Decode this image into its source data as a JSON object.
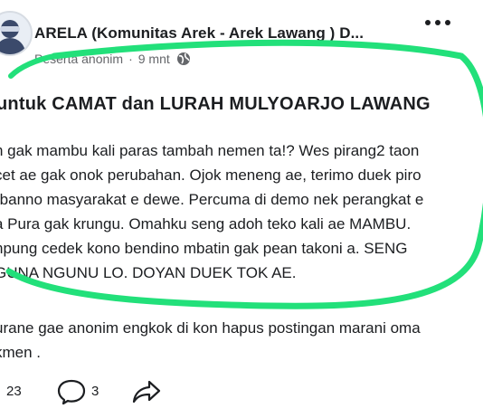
{
  "post": {
    "group_name": "ARELA (Komunitas Arek - Arek Lawang ) D...",
    "author": "Peserta anonim",
    "separator": "·",
    "time": "9 mnt",
    "title": "untuk CAMAT dan LURAH MULYOARJO LAWANG",
    "body_lines": [
      "n gak mambu kali paras tambah nemen ta!? Wes pirang2 taon",
      "cet ae gak onok perubahan. Ojok meneng ae, terimo duek piro",
      "rbanno masyarakat e dewe. Percuma di demo nek perangkat e",
      "a Pura gak krungu. Omahku seng adoh teko kali ae MAMBU.",
      "npung cedek kono bendino mbatin gak pean takoni a. SENG",
      "GUNA NGUNU LO. DOYAN DUEK TOK AE.",
      "urane gae anonim engkok di kon hapus postingan marani oma",
      "kmen ."
    ]
  },
  "footer": {
    "reactions": "23",
    "comments": "3"
  },
  "icons": {
    "more": "more-dots-icon",
    "privacy": "globe-icon",
    "comment": "comment-icon",
    "share": "share-icon"
  },
  "colors": {
    "highlight": "#22e07a",
    "text": "#1c1e21",
    "meta": "#65676b"
  }
}
